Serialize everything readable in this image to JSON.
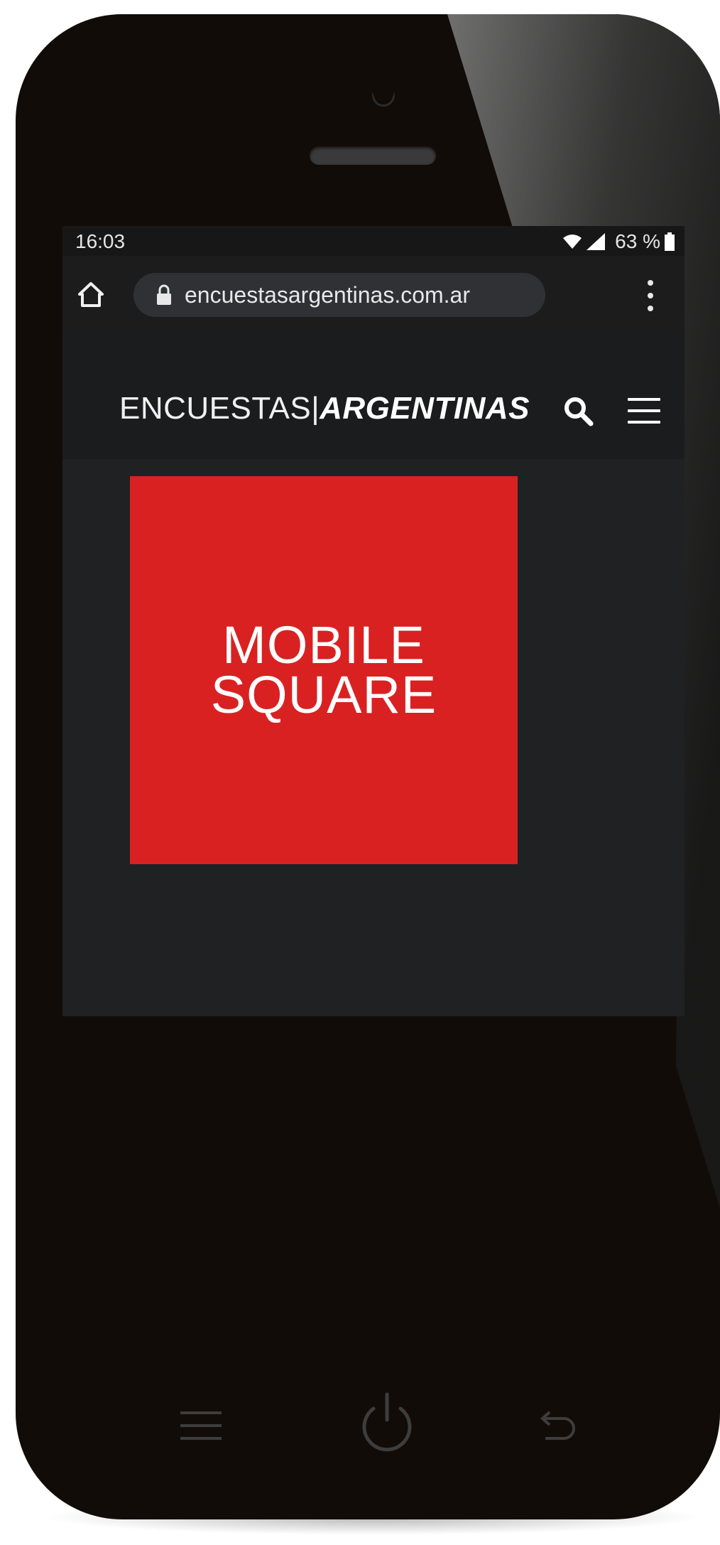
{
  "status_bar": {
    "time": "16:03",
    "battery": "63 %"
  },
  "browser": {
    "url": "encuestasargentinas.com.ar"
  },
  "site": {
    "logo_part1": "ENCUESTAS",
    "logo_separator": "|",
    "logo_part2": "ARGENTINAS"
  },
  "ad": {
    "line1": "MOBILE",
    "line2": "SQUARE",
    "color": "#d92122"
  },
  "icons": {
    "home": "home-icon",
    "lock": "lock-icon",
    "menu": "kebab-menu-icon",
    "search": "search-icon",
    "hamburger": "hamburger-menu-icon",
    "power": "power-icon",
    "back": "back-icon"
  },
  "colors": {
    "phone_body": "#120c08",
    "screen_bg": "#202122",
    "url_field": "#303134"
  }
}
